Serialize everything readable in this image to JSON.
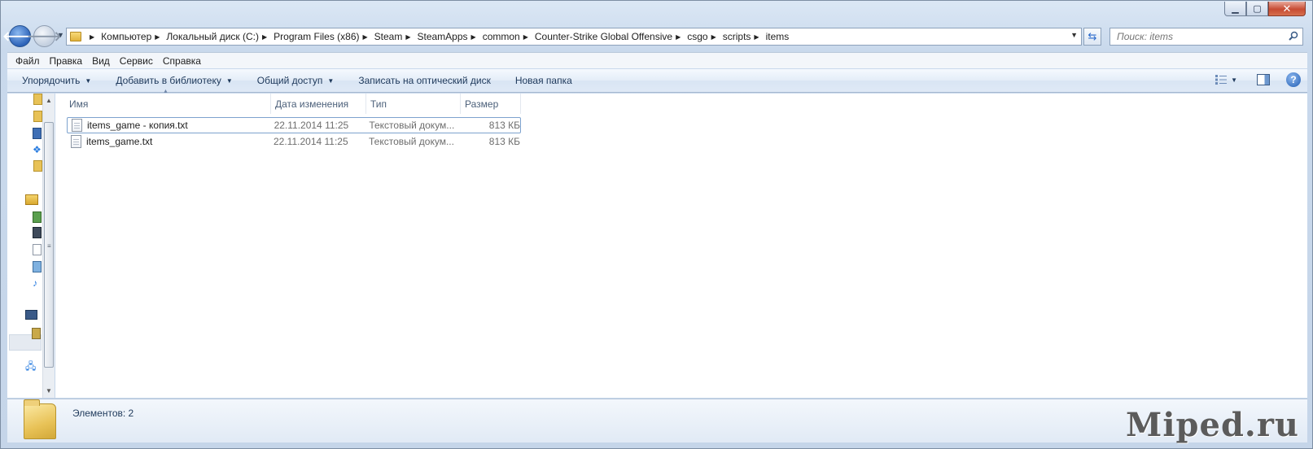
{
  "window": {
    "minimize_icon": "minimize-icon",
    "maximize_icon": "maximize-icon",
    "close_icon": "close-icon"
  },
  "address": {
    "breadcrumbs": [
      "Компьютер",
      "Локальный диск (C:)",
      "Program Files (x86)",
      "Steam",
      "SteamApps",
      "common",
      "Counter-Strike Global Offensive",
      "csgo",
      "scripts",
      "items"
    ]
  },
  "search": {
    "placeholder": "Поиск: items"
  },
  "menu": {
    "items": [
      "Файл",
      "Правка",
      "Вид",
      "Сервис",
      "Справка"
    ]
  },
  "toolbar": {
    "organize_label": "Упорядочить",
    "add_library_label": "Добавить в библиотеку",
    "share_label": "Общий доступ",
    "burn_label": "Записать на оптический диск",
    "new_folder_label": "Новая папка"
  },
  "columns": {
    "name": "Имя",
    "date": "Дата изменения",
    "type": "Тип",
    "size": "Размер"
  },
  "files": [
    {
      "name": "items_game - копия.txt",
      "date": "22.11.2014 11:25",
      "type": "Текстовый докум...",
      "size": "813 КБ",
      "selected": true
    },
    {
      "name": "items_game.txt",
      "date": "22.11.2014 11:25",
      "type": "Текстовый докум...",
      "size": "813 КБ",
      "selected": false
    }
  ],
  "details": {
    "item_count": "Элементов: 2"
  },
  "watermark": "Miped.ru",
  "colors": {
    "accent": "#2d63b8",
    "selection_border": "#7da2ce",
    "toolbar_text": "#1e395b"
  }
}
